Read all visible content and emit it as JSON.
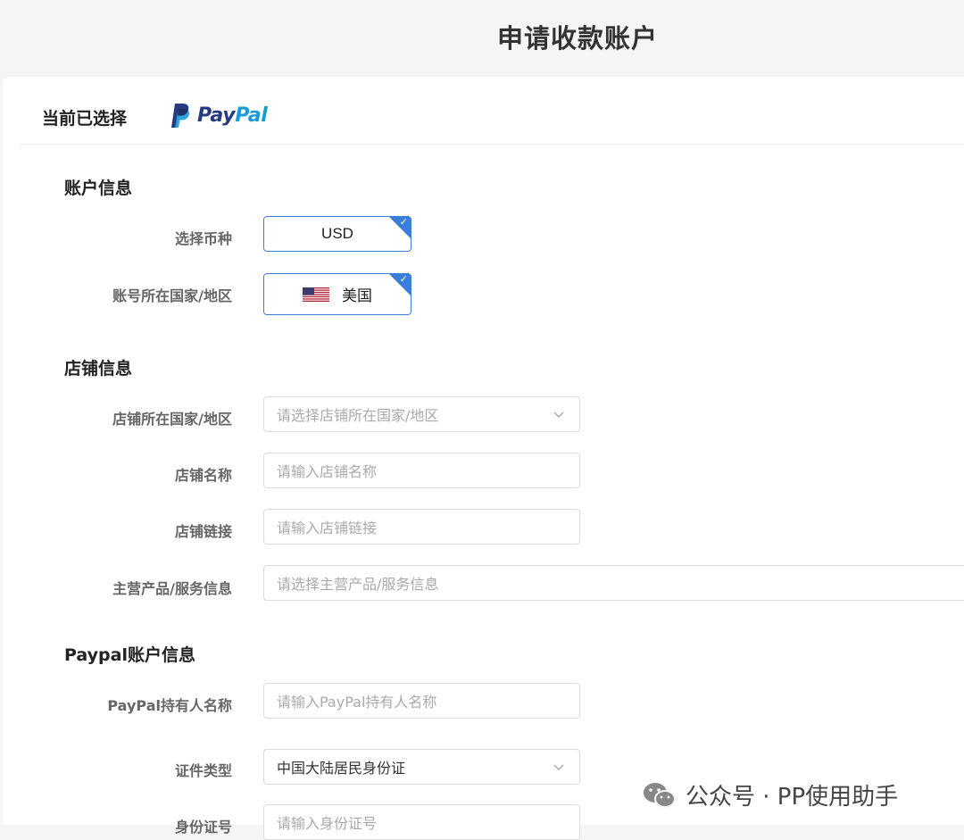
{
  "header": {
    "title": "申请收款账户"
  },
  "selected": {
    "label": "当前已选择",
    "provider_pay": "Pay",
    "provider_pal": "Pal"
  },
  "sections": {
    "account": {
      "title": "账户信息"
    },
    "store": {
      "title": "店铺信息"
    },
    "paypal": {
      "title": "Paypal账户信息"
    }
  },
  "fields": {
    "currency": {
      "label": "选择币种",
      "value": "USD"
    },
    "account_country": {
      "label": "账号所在国家/地区",
      "value": "美国",
      "flag_icon": "us-flag-icon"
    },
    "store_country": {
      "label": "店铺所在国家/地区",
      "placeholder": "请选择店铺所在国家/地区"
    },
    "store_name": {
      "label": "店铺名称",
      "placeholder": "请输入店铺名称"
    },
    "store_link": {
      "label": "店铺链接",
      "placeholder": "请输入店铺链接"
    },
    "main_product": {
      "label": "主营产品/服务信息",
      "placeholder": "请选择主营产品/服务信息"
    },
    "holder_name": {
      "label": "PayPal持有人名称",
      "placeholder": "请输入PayPal持有人名称"
    },
    "id_type": {
      "label": "证件类型",
      "value": "中国大陆居民身份证"
    },
    "id_number": {
      "label": "身份证号",
      "placeholder": "请输入身份证号"
    }
  },
  "watermark": {
    "text": "公众号 · PP使用助手"
  },
  "colors": {
    "accent": "#3b7ddd",
    "paypal_dark": "#253b80",
    "paypal_light": "#179bd7"
  }
}
